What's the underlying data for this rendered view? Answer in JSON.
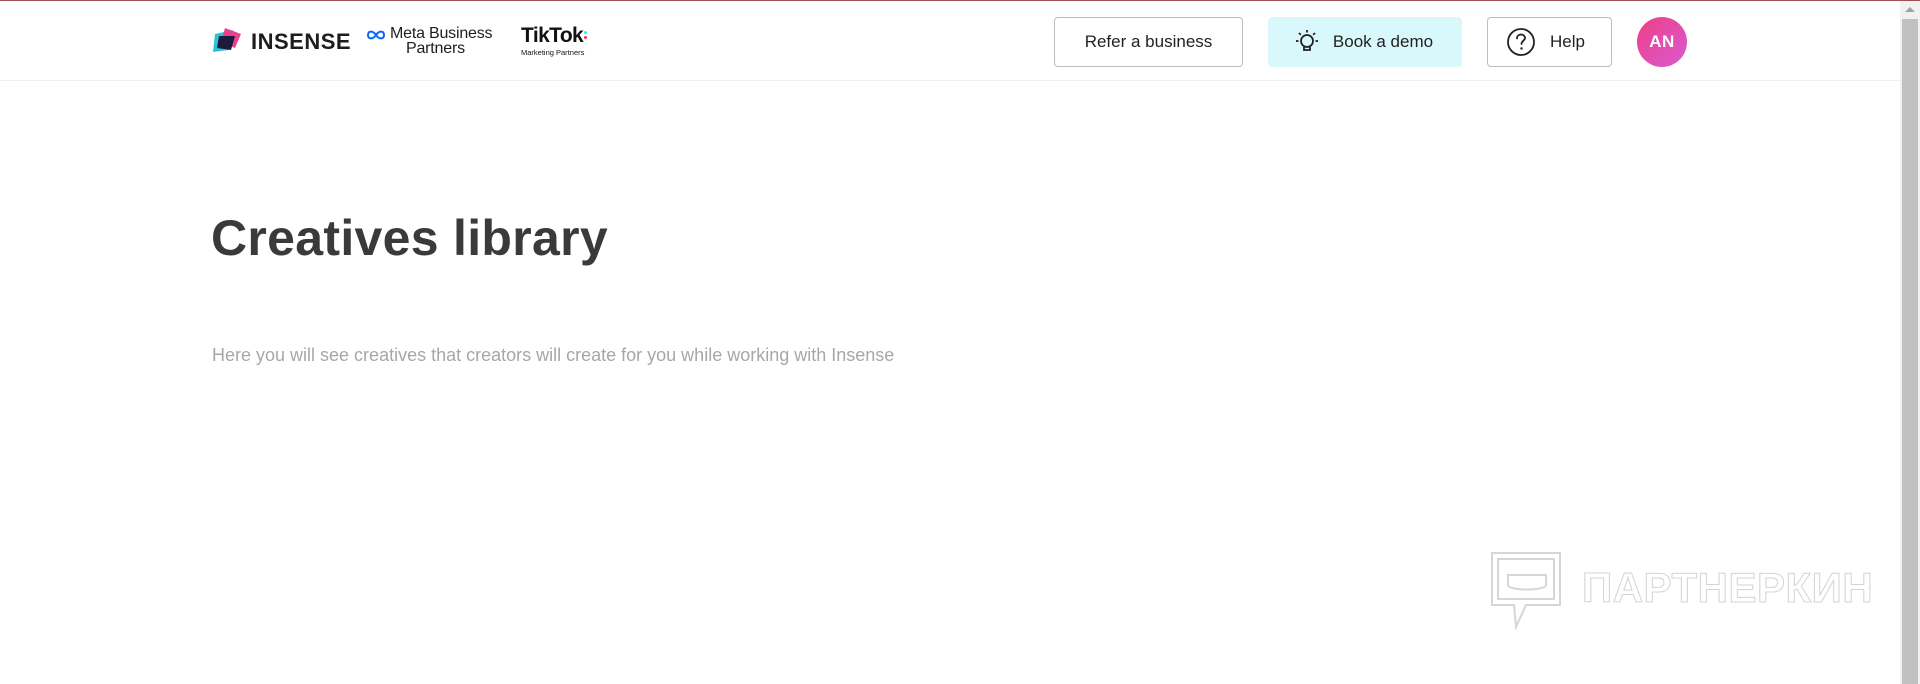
{
  "header": {
    "brand": {
      "name": "INSENSE"
    },
    "partners": {
      "meta": {
        "line1": "Meta Business",
        "line2": "Partners"
      },
      "tiktok": {
        "name": "TikTok",
        "sub": "Marketing Partners"
      }
    },
    "refer_label": "Refer a business",
    "demo_label": "Book a demo",
    "help_label": "Help",
    "avatar_initials": "AN"
  },
  "main": {
    "title": "Creatives library",
    "subtitle": "Here you will see creatives that creators will create for you while working with Insense"
  },
  "watermark": {
    "text": "ПАРТНЕРКИН"
  },
  "icons": {
    "brand": "insense-logo-icon",
    "meta": "meta-infinity-icon",
    "demo": "lightbulb-icon",
    "help": "question-circle-icon",
    "watermark": "chat-bubble-icon"
  },
  "colors": {
    "demo_button_bg": "#d9f8fb",
    "avatar_gradient_start": "#ee3f86",
    "avatar_gradient_end": "#d95bd0",
    "title": "#3a3a3a",
    "subtitle": "#a7a7a7"
  }
}
